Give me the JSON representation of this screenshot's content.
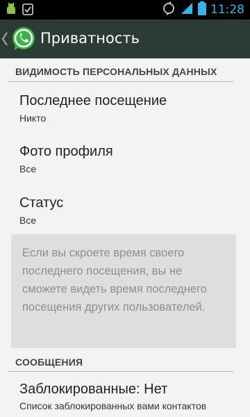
{
  "status_bar": {
    "time": "11:28",
    "colors": {
      "time": "#34b5e5",
      "signal": "#34b5e5",
      "battery": "#34b5e5"
    }
  },
  "action_bar": {
    "title": "Приватность",
    "icons": [
      "back-chevron-icon",
      "whatsapp-logo-icon"
    ]
  },
  "sections": {
    "personal_data": {
      "header": "ВИДИМОСТЬ ПЕРСОНАЛЬНЫХ ДАННЫХ",
      "items": [
        {
          "title": "Последнее посещение",
          "value": "Никто"
        },
        {
          "title": "Фото профиля",
          "value": "Все"
        },
        {
          "title": "Статус",
          "value": "Все"
        }
      ],
      "info": "Если вы скроете время своего последнего посещения, вы не сможете видеть время последнего посещения других пользователей."
    },
    "messages": {
      "header": "СООБЩЕНИЯ",
      "blocked": {
        "title": "Заблокированные: Нет",
        "subtitle": "Список заблокированных вами контактов"
      }
    }
  }
}
